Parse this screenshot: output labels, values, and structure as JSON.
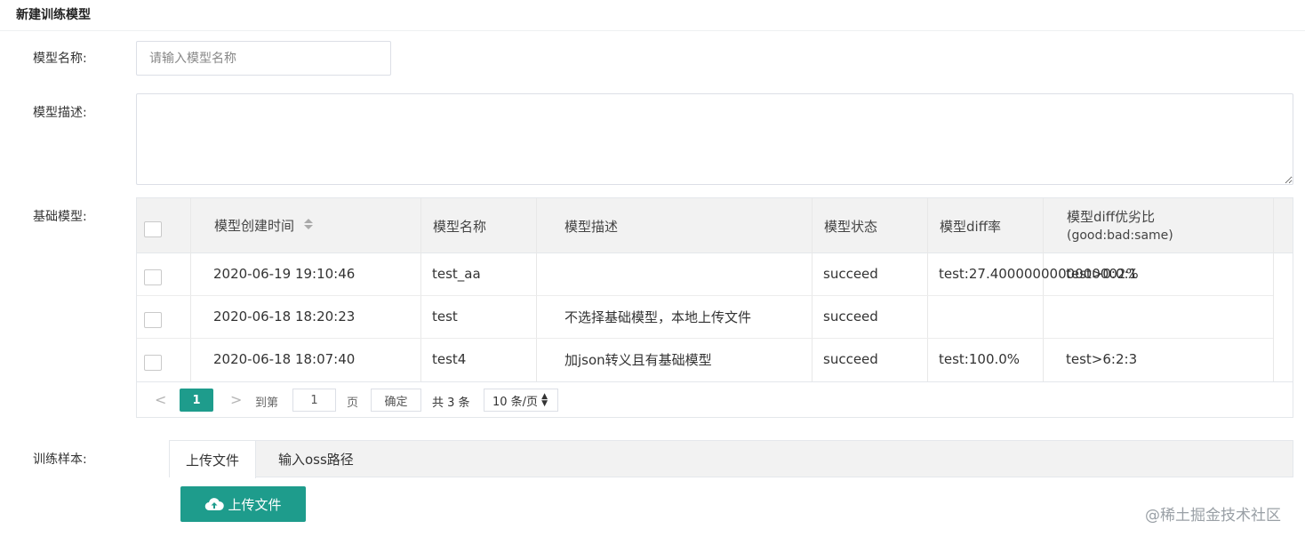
{
  "page": {
    "title": "新建训练模型"
  },
  "form": {
    "name_label": "模型名称:",
    "name_placeholder": "请输入模型名称",
    "desc_label": "模型描述:",
    "base_label": "基础模型:",
    "sample_label": "训练样本:"
  },
  "table": {
    "headers": {
      "created": "模型创建时间",
      "name": "模型名称",
      "desc": "模型描述",
      "status": "模型状态",
      "diff": "模型diff率",
      "ratio_line1": "模型diff优劣比",
      "ratio_line2": "(good:bad:same)"
    },
    "rows": [
      {
        "created": "2020-06-19 19:10:46",
        "name": "test_aa",
        "desc": "",
        "status": "succeed",
        "diff": "test:27.4000000000000002%",
        "ratio": "test>0:0:1"
      },
      {
        "created": "2020-06-18 18:20:23",
        "name": "test",
        "desc": "不选择基础模型，本地上传文件",
        "status": "succeed",
        "diff": "",
        "ratio": ""
      },
      {
        "created": "2020-06-18 18:07:40",
        "name": "test4",
        "desc": "加json转义且有基础模型",
        "status": "succeed",
        "diff": "test:100.0%",
        "ratio": "test>6:2:3"
      }
    ]
  },
  "pagination": {
    "prev": "<",
    "current": "1",
    "next": ">",
    "goto_label": "到第",
    "goto_value": "1",
    "page_unit": "页",
    "confirm": "确定",
    "total": "共 3 条",
    "page_size": "10 条/页"
  },
  "tabs": [
    {
      "label": "上传文件",
      "active": true
    },
    {
      "label": "输入oss路径",
      "active": false
    }
  ],
  "upload_button": "上传文件",
  "watermark": "@稀土掘金技术社区",
  "colors": {
    "primary": "#1e9c8c"
  }
}
